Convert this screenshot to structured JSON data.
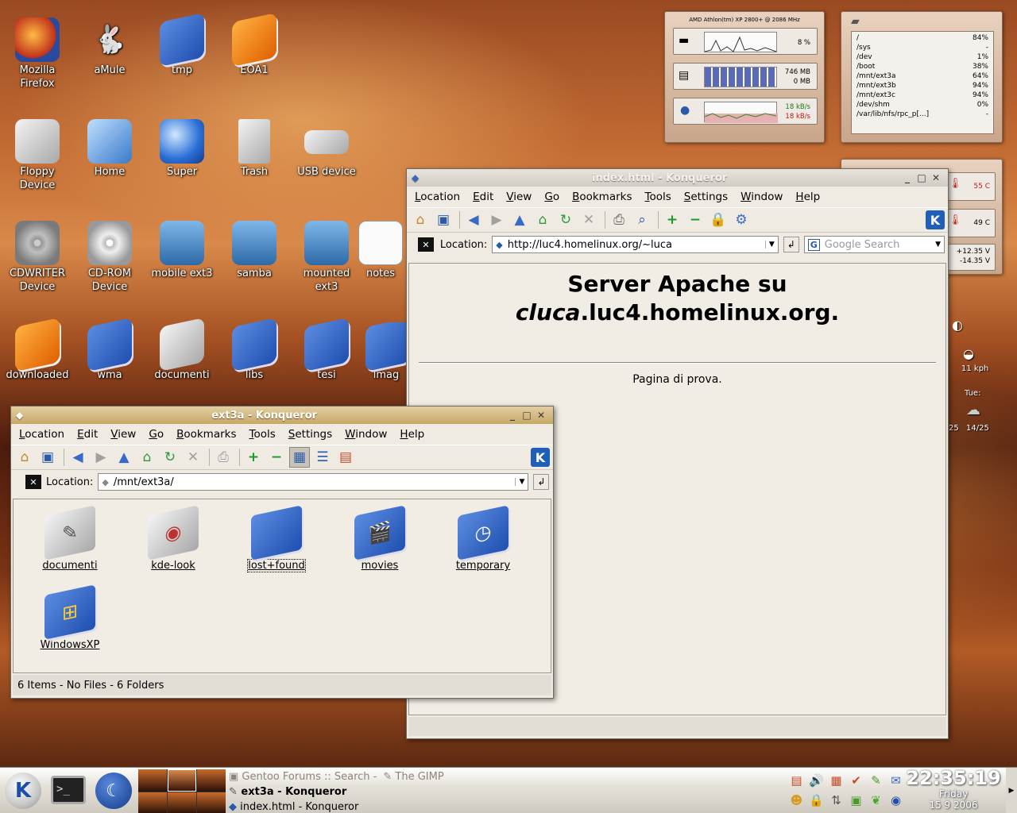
{
  "desktop": {
    "icons": [
      {
        "label": "Mozilla Firefox",
        "icon": "firefox-icon"
      },
      {
        "label": "aMule",
        "icon": "amule-icon"
      },
      {
        "label": "tmp",
        "icon": "folder-icon"
      },
      {
        "label": "EOA1",
        "icon": "folder-icon"
      },
      {
        "label": "Floppy Device",
        "icon": "floppy-icon"
      },
      {
        "label": "Home",
        "icon": "monitor-icon"
      },
      {
        "label": "Super",
        "icon": "globe-icon"
      },
      {
        "label": "Trash",
        "icon": "trash-icon"
      },
      {
        "label": "USB device",
        "icon": "usb-icon"
      },
      {
        "label": "CDWRITER Device",
        "icon": "cdwriter-icon"
      },
      {
        "label": "CD-ROM Device",
        "icon": "cdrom-icon"
      },
      {
        "label": "mobile ext3",
        "icon": "drive-icon"
      },
      {
        "label": "samba",
        "icon": "drive-icon"
      },
      {
        "label": "mounted ext3",
        "icon": "drive-icon"
      },
      {
        "label": "notes",
        "icon": "document-icon"
      },
      {
        "label": "downloaded",
        "icon": "folder-icon"
      },
      {
        "label": "wma",
        "icon": "folder-icon"
      },
      {
        "label": "documenti",
        "icon": "folder-icon"
      },
      {
        "label": "libs",
        "icon": "folder-icon"
      },
      {
        "label": "tesi",
        "icon": "folder-icon"
      },
      {
        "label": "imag",
        "icon": "folder-icon"
      }
    ]
  },
  "sysmon": {
    "cpu_title": "AMD Athlon(tm) XP 2800+ @ 2086 MHz",
    "cpu_value": "8 %",
    "mem_value1": "746 MB",
    "mem_value2": "0 MB",
    "net_value1": "18 kB/s",
    "net_value2": "18 kB/s",
    "disks": [
      {
        "mount": "/",
        "usage": "84%"
      },
      {
        "mount": "/sys",
        "usage": "-"
      },
      {
        "mount": "/dev",
        "usage": "1%"
      },
      {
        "mount": "/boot",
        "usage": "38%"
      },
      {
        "mount": "/mnt/ext3a",
        "usage": "64%"
      },
      {
        "mount": "/mnt/ext3b",
        "usage": "94%"
      },
      {
        "mount": "/mnt/ext3c",
        "usage": "94%"
      },
      {
        "mount": "/dev/shm",
        "usage": "0%"
      },
      {
        "mount": "/var/lib/nfs/rpc_p[...]",
        "usage": "-"
      }
    ],
    "temp1": "55 C",
    "temp2": "49 C",
    "volt1": "+12.35 V",
    "volt2": "-14.35 V",
    "wind": "11 kph",
    "day_label": "Tue:",
    "temp_left": "25",
    "temp_right": "14/25"
  },
  "browser": {
    "title": "index.html - Konqueror",
    "menu": [
      "Location",
      "Edit",
      "View",
      "Go",
      "Bookmarks",
      "Tools",
      "Settings",
      "Window",
      "Help"
    ],
    "location_label": "Location:",
    "url": "http://luc4.homelinux.org/~luca",
    "search_placeholder": "Google Search",
    "heading_line1": "Server Apache su",
    "heading_host_italic": "cluca",
    "heading_host_rest": ".luc4.homelinux.org.",
    "body_text": "Pagina di prova."
  },
  "filemanager": {
    "title": "ext3a - Konqueror",
    "menu": [
      "Location",
      "Edit",
      "View",
      "Go",
      "Bookmarks",
      "Tools",
      "Settings",
      "Window",
      "Help"
    ],
    "location_label": "Location:",
    "path": "/mnt/ext3a/",
    "items": [
      {
        "label": "documenti",
        "icon": "folder-tools-icon"
      },
      {
        "label": "kde-look",
        "icon": "folder-colors-icon"
      },
      {
        "label": "lost+found",
        "icon": "folder-icon"
      },
      {
        "label": "movies",
        "icon": "folder-video-icon"
      },
      {
        "label": "temporary",
        "icon": "folder-clock-icon"
      },
      {
        "label": "WindowsXP",
        "icon": "folder-windows-icon"
      }
    ],
    "status": "6 Items - No Files - 6 Folders"
  },
  "taskbar": {
    "tasks": [
      "Gentoo Forums :: Search -",
      "The GIMP",
      "ext3a - Konqueror",
      "index.html - Konqueror"
    ],
    "clock_time": "22:35:19",
    "clock_day": "Friday",
    "clock_date": "15 9 2006"
  }
}
